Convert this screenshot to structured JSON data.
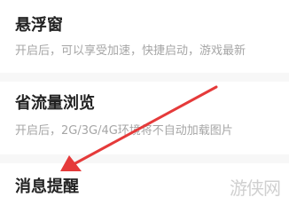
{
  "settings": [
    {
      "title": "悬浮窗",
      "description": "开启后，可以享受加速，快捷启动，游戏最新"
    },
    {
      "title": "省流量浏览",
      "description": "开启后，2G/3G/4G环境将不自动加载图片"
    },
    {
      "title": "消息提醒"
    }
  ],
  "annotation": {
    "arrow_color": "#e53a3a"
  },
  "watermark": {
    "text": "游侠网"
  }
}
